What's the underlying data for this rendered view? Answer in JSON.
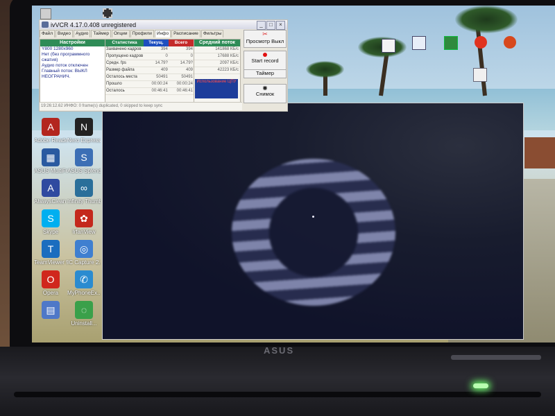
{
  "window": {
    "title": "ivVCR 4.17.0.408 unregistered",
    "minimize": "_",
    "maximize": "□",
    "close": "×"
  },
  "tabs": [
    "Файл",
    "Видео",
    "Аудио",
    "Таймер",
    "Опции",
    "Профили",
    "Инфо",
    "Расписание",
    "Фильтры"
  ],
  "tab_nav": "◂ ▸",
  "settings": {
    "header": "Настройки",
    "lines": [
      "Y800 1280x960",
      "Нет (без программного",
      "сжатия)",
      "Аудио поток отключен",
      "",
      "Главный поток: ВЫКЛ",
      "НЕОГРАНИЧ."
    ]
  },
  "stats": {
    "headers": [
      "Статистика",
      "Текущ.",
      "Всего"
    ],
    "rows": [
      {
        "name": "Захвачено кадров",
        "current": "394",
        "total": "394"
      },
      {
        "name": "Пропущено кадров",
        "current": "0",
        "total": "0"
      },
      {
        "name": "Средн. fps",
        "current": "14.79?",
        "total": "14.79?"
      },
      {
        "name": "Размер файла",
        "current": "409",
        "total": "409"
      },
      {
        "name": "Осталось места",
        "current": "50491",
        "total": "50491"
      },
      {
        "name": "Прошло",
        "current": "00:00:24",
        "total": "00:00:24"
      },
      {
        "name": "Осталось",
        "current": "00:46:41",
        "total": "00:46:41"
      }
    ]
  },
  "stream": {
    "header": "Средний поток",
    "rows": [
      "141868 КБ/c",
      "17688 КБ/c",
      "2097 КБ/c",
      "42223 КБ/c"
    ],
    "usage_label": "Использование ЦПУ"
  },
  "controls": {
    "preview": "Просмотр Выкл",
    "record": "Start record",
    "timer": "Таймер",
    "snapshot": "Снимок"
  },
  "statusbar": "19:26:12.62 ИНФО: 0 frame(s) duplicated, 0 skipped to keep sync",
  "desktop_icons": [
    "Adobe Reader",
    "Nero Express Essentials",
    "ASUS MultiFrame",
    "ASUS Splendid Technology",
    "AlwaysClean Utility",
    "Infinity Thumbnail",
    "Skype",
    "IrfanView",
    "TeamViewer 9",
    "IC Capture 2.2",
    "Opera",
    "MyPhoneEx...",
    "",
    "Uninstall..."
  ],
  "brand": "ASUS",
  "colors": {
    "settings_header": "#2f8c57",
    "stats_header": "#2f8c57",
    "current_header": "#1f4fbf",
    "total_header": "#c42b2b",
    "stream_header": "#2f8c57",
    "cpu_usage_bg": "#1d3d9a",
    "record_dot": "#e11111"
  }
}
